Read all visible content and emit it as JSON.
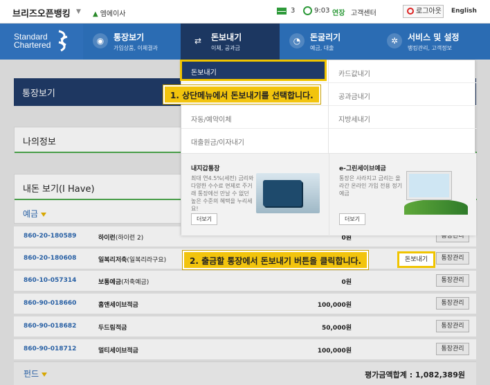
{
  "topbar": {
    "brand": "브리즈오픈뱅킹",
    "user": "엠에이사",
    "mail_count": "3",
    "timer": "9:03",
    "extend": "연장",
    "support": "고객센터",
    "logout": "로그아웃",
    "lang": "English"
  },
  "nav": {
    "logo_line1": "Standard",
    "logo_line2": "Chartered",
    "items": [
      {
        "title": "통장보기",
        "sub": "가입상품, 이체결과"
      },
      {
        "title": "돈보내기",
        "sub": "이체, 공과금"
      },
      {
        "title": "돈굴리기",
        "sub": "예금, 대출"
      },
      {
        "title": "서비스 및 설정",
        "sub": "뱅킹관리, 고객정보"
      }
    ]
  },
  "dropdown": {
    "left_items": [
      "돈보내기",
      "",
      "자동/예약이체",
      "대출원금/이자내기"
    ],
    "right_items": [
      "카드값내기",
      "공과금내기",
      "지방세내기"
    ],
    "promo1": {
      "title": "내지갑통장",
      "text": "최대 연4.5%(세전) 금리와 다양한 수수료 면제로 주거래 통장에선 만날 수 없던 높은 수준의 혜택을 누리세요!",
      "button": "더보기"
    },
    "promo2": {
      "title": "e-그린세이브예금",
      "text": "통장은 사라지고 금리는 올라간 온라인 가입 전용 정기예금",
      "button": "더보기"
    }
  },
  "callouts": {
    "step1": "1. 상단메뉴에서 돈보내기를 선택합니다.",
    "step2": "2. 출금할 통장에서 돈보내기 버튼을 클릭합니다."
  },
  "main": {
    "panel_title": "통장보기",
    "info_title": "나의정보",
    "assets_title": "내돈 보기(I Have)",
    "category_deposit": "예금",
    "category_fund": "펀드",
    "send_button": "돈보내기",
    "manage_button": "통장관리",
    "total": "평가금액합계 : 1,082,389원",
    "accounts": [
      {
        "number": "860-20-180589",
        "name": "하이런",
        "sub": "(하이런 2)",
        "balance": "0원"
      },
      {
        "number": "860-20-180608",
        "name": "일복리저축",
        "sub": "(일복리라구요)",
        "balance": ""
      },
      {
        "number": "860-10-057314",
        "name": "보통예금",
        "sub": "(저축예금)",
        "balance": "0원"
      },
      {
        "number": "860-90-018660",
        "name": "홈앤세이브적금",
        "sub": "",
        "balance": "100,000원"
      },
      {
        "number": "860-90-018682",
        "name": "두드림적금",
        "sub": "",
        "balance": "50,000원"
      },
      {
        "number": "860-90-018712",
        "name": "멀티세이브적금",
        "sub": "",
        "balance": "100,000원"
      }
    ]
  }
}
